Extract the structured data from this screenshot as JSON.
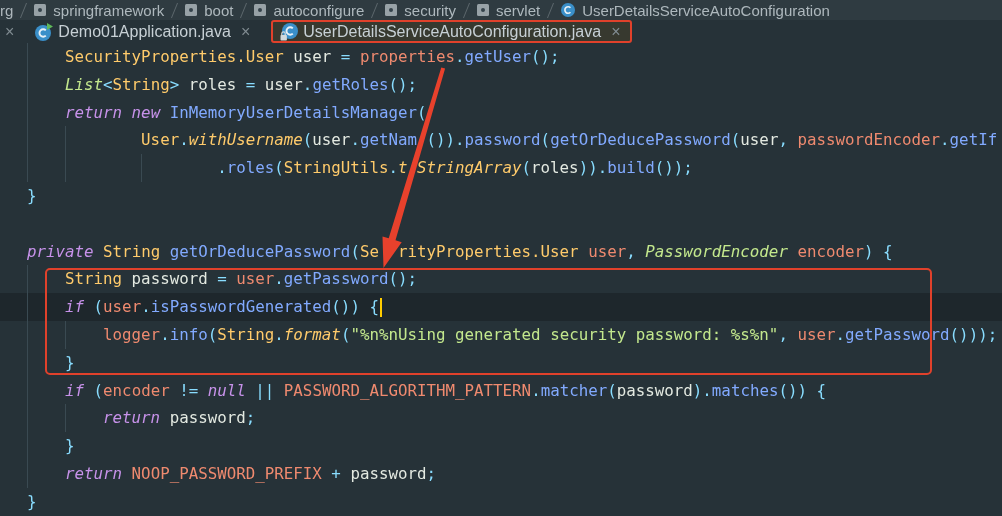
{
  "breadcrumbs": [
    {
      "kind": "text",
      "label": "rg"
    },
    {
      "kind": "package",
      "label": "springframework"
    },
    {
      "kind": "package",
      "label": "boot"
    },
    {
      "kind": "package",
      "label": "autoconfigure"
    },
    {
      "kind": "package",
      "label": "security"
    },
    {
      "kind": "package",
      "label": "servlet"
    },
    {
      "kind": "class",
      "label": "UserDetailsServiceAutoConfiguration"
    }
  ],
  "tabs": [
    {
      "kind": "partial",
      "close": "×",
      "selected": false,
      "boxed": false
    },
    {
      "kind": "main-class",
      "label": "Demo01Application.java",
      "close": "×",
      "selected": false,
      "boxed": false
    },
    {
      "kind": "read-only-class",
      "label": "UserDetailsServiceAutoConfiguration.java",
      "close": "×",
      "selected": true,
      "boxed": true
    }
  ],
  "code": {
    "blocks": [
      {
        "body": [
          {
            "kind": "statement",
            "current": false,
            "boxed": false,
            "tokens": [
              {
                "kind": "type",
                "text": "SecurityProperties.User"
              },
              {
                "kind": "plain",
                "text": " user "
              },
              {
                "kind": "punct",
                "text": "= "
              },
              {
                "kind": "field",
                "text": "properties"
              },
              {
                "kind": "punct",
                "text": "."
              },
              {
                "kind": "method",
                "text": "getUser"
              },
              {
                "kind": "punct",
                "text": "();"
              }
            ]
          },
          {
            "kind": "statement",
            "current": false,
            "boxed": false,
            "tokens": [
              {
                "kind": "interface",
                "text": "List"
              },
              {
                "kind": "punct",
                "text": "<"
              },
              {
                "kind": "type",
                "text": "String"
              },
              {
                "kind": "punct",
                "text": "> "
              },
              {
                "kind": "plain",
                "text": "roles "
              },
              {
                "kind": "punct",
                "text": "= "
              },
              {
                "kind": "plain",
                "text": "user"
              },
              {
                "kind": "punct",
                "text": "."
              },
              {
                "kind": "method",
                "text": "getRoles"
              },
              {
                "kind": "punct",
                "text": "();"
              }
            ]
          },
          {
            "kind": "statement",
            "current": false,
            "boxed": false,
            "tokens": [
              {
                "kind": "keyword",
                "text": "return new "
              },
              {
                "kind": "method",
                "text": "InMemoryUserDetailsManager"
              },
              {
                "kind": "punct",
                "text": "("
              }
            ],
            "children": [
              {
                "kind": "continuation",
                "current": false,
                "boxed": false,
                "tokens": [
                  {
                    "kind": "type",
                    "text": "User"
                  },
                  {
                    "kind": "punct",
                    "text": "."
                  },
                  {
                    "kind": "static",
                    "text": "withUsername"
                  },
                  {
                    "kind": "punct",
                    "text": "("
                  },
                  {
                    "kind": "plain",
                    "text": "user"
                  },
                  {
                    "kind": "punct",
                    "text": "."
                  },
                  {
                    "kind": "method",
                    "text": "getNam "
                  },
                  {
                    "kind": "punct",
                    "text": "())."
                  },
                  {
                    "kind": "method",
                    "text": "password"
                  },
                  {
                    "kind": "punct",
                    "text": "("
                  },
                  {
                    "kind": "method",
                    "text": "getOrDeducePassword"
                  },
                  {
                    "kind": "punct",
                    "text": "("
                  },
                  {
                    "kind": "plain",
                    "text": "user"
                  },
                  {
                    "kind": "punct",
                    "text": ", "
                  },
                  {
                    "kind": "field",
                    "text": "passwordEncoder"
                  },
                  {
                    "kind": "punct",
                    "text": "."
                  },
                  {
                    "kind": "method",
                    "text": "getIf"
                  }
                ],
                "children": [
                  {
                    "kind": "continuation",
                    "current": false,
                    "boxed": false,
                    "tokens": [
                      {
                        "kind": "punct",
                        "text": "."
                      },
                      {
                        "kind": "method",
                        "text": "roles"
                      },
                      {
                        "kind": "punct",
                        "text": "("
                      },
                      {
                        "kind": "type",
                        "text": "StringUtils"
                      },
                      {
                        "kind": "punct",
                        "text": "."
                      },
                      {
                        "kind": "static",
                        "text": "t StringArray"
                      },
                      {
                        "kind": "punct",
                        "text": "("
                      },
                      {
                        "kind": "plain",
                        "text": "roles"
                      },
                      {
                        "kind": "punct",
                        "text": "))."
                      },
                      {
                        "kind": "method",
                        "text": "build"
                      },
                      {
                        "kind": "punct",
                        "text": "());"
                      }
                    ]
                  }
                ]
              }
            ]
          }
        ],
        "close": {
          "current": false,
          "boxed": false,
          "tokens": [
            {
              "kind": "punct",
              "text": "}"
            }
          ]
        }
      },
      {
        "header": {
          "current": false,
          "boxed": false,
          "tokens": [
            {
              "kind": "keyword",
              "text": "private "
            },
            {
              "kind": "type",
              "text": "String "
            },
            {
              "kind": "method",
              "text": "getOrDeducePassword"
            },
            {
              "kind": "punct",
              "text": "("
            },
            {
              "kind": "type",
              "text": "Se  rityProperties.User "
            },
            {
              "kind": "field",
              "text": "user"
            },
            {
              "kind": "punct",
              "text": ", "
            },
            {
              "kind": "interface",
              "text": "PasswordEncoder "
            },
            {
              "kind": "field",
              "text": "encoder"
            },
            {
              "kind": "punct",
              "text": ") {"
            }
          ]
        },
        "body": [
          {
            "kind": "statement",
            "current": false,
            "boxed": true,
            "tokens": [
              {
                "kind": "type",
                "text": "String "
              },
              {
                "kind": "plain",
                "text": "password "
              },
              {
                "kind": "punct",
                "text": "= "
              },
              {
                "kind": "field",
                "text": "user"
              },
              {
                "kind": "punct",
                "text": "."
              },
              {
                "kind": "method",
                "text": "getPassword"
              },
              {
                "kind": "punct",
                "text": "();"
              }
            ]
          },
          {
            "kind": "statement",
            "current": true,
            "boxed": true,
            "tokens": [
              {
                "kind": "keyword",
                "text": "if "
              },
              {
                "kind": "punct",
                "text": "("
              },
              {
                "kind": "field",
                "text": "user"
              },
              {
                "kind": "punct",
                "text": "."
              },
              {
                "kind": "method",
                "text": "isPasswordGenerated"
              },
              {
                "kind": "punct",
                "text": "()) {"
              }
            ],
            "children": [
              {
                "kind": "statement",
                "current": false,
                "boxed": true,
                "tokens": [
                  {
                    "kind": "field",
                    "text": "logger"
                  },
                  {
                    "kind": "punct",
                    "text": "."
                  },
                  {
                    "kind": "method",
                    "text": "info"
                  },
                  {
                    "kind": "punct",
                    "text": "("
                  },
                  {
                    "kind": "type",
                    "text": "String"
                  },
                  {
                    "kind": "punct",
                    "text": "."
                  },
                  {
                    "kind": "static",
                    "text": "format"
                  },
                  {
                    "kind": "punct",
                    "text": "("
                  },
                  {
                    "kind": "string",
                    "text": "\"%n%nUsing generated security password: %s%n\""
                  },
                  {
                    "kind": "punct",
                    "text": ", "
                  },
                  {
                    "kind": "field",
                    "text": "user"
                  },
                  {
                    "kind": "punct",
                    "text": "."
                  },
                  {
                    "kind": "method",
                    "text": "getPassword"
                  },
                  {
                    "kind": "punct",
                    "text": "()));"
                  }
                ]
              }
            ]
          },
          {
            "kind": "statement",
            "current": false,
            "boxed": true,
            "tokens": [
              {
                "kind": "punct",
                "text": "}"
              }
            ]
          },
          {
            "kind": "statement",
            "current": false,
            "boxed": false,
            "tokens": [
              {
                "kind": "keyword",
                "text": "if "
              },
              {
                "kind": "punct",
                "text": "("
              },
              {
                "kind": "field",
                "text": "encoder "
              },
              {
                "kind": "punct",
                "text": "!= "
              },
              {
                "kind": "keyword",
                "text": "null "
              },
              {
                "kind": "punct",
                "text": "|| "
              },
              {
                "kind": "field",
                "text": "PASSWORD_ALGORITHM_PATTERN"
              },
              {
                "kind": "punct",
                "text": "."
              },
              {
                "kind": "method",
                "text": "matcher"
              },
              {
                "kind": "punct",
                "text": "("
              },
              {
                "kind": "plain",
                "text": "password"
              },
              {
                "kind": "punct",
                "text": ")."
              },
              {
                "kind": "method",
                "text": "matches"
              },
              {
                "kind": "punct",
                "text": "()) {"
              }
            ],
            "children": [
              {
                "kind": "statement",
                "current": false,
                "boxed": false,
                "tokens": [
                  {
                    "kind": "keyword",
                    "text": "return "
                  },
                  {
                    "kind": "plain",
                    "text": "password"
                  },
                  {
                    "kind": "punct",
                    "text": ";"
                  }
                ]
              }
            ]
          },
          {
            "kind": "statement",
            "current": false,
            "boxed": false,
            "tokens": [
              {
                "kind": "punct",
                "text": "}"
              }
            ]
          },
          {
            "kind": "statement",
            "current": false,
            "boxed": false,
            "tokens": [
              {
                "kind": "keyword",
                "text": "return "
              },
              {
                "kind": "field",
                "text": "NOOP_PASSWORD_PREFIX "
              },
              {
                "kind": "punct",
                "text": "+ "
              },
              {
                "kind": "plain",
                "text": "password"
              },
              {
                "kind": "punct",
                "text": ";"
              }
            ]
          }
        ],
        "close": {
          "current": false,
          "boxed": false,
          "tokens": [
            {
              "kind": "punct",
              "text": "}"
            }
          ]
        }
      }
    ]
  }
}
